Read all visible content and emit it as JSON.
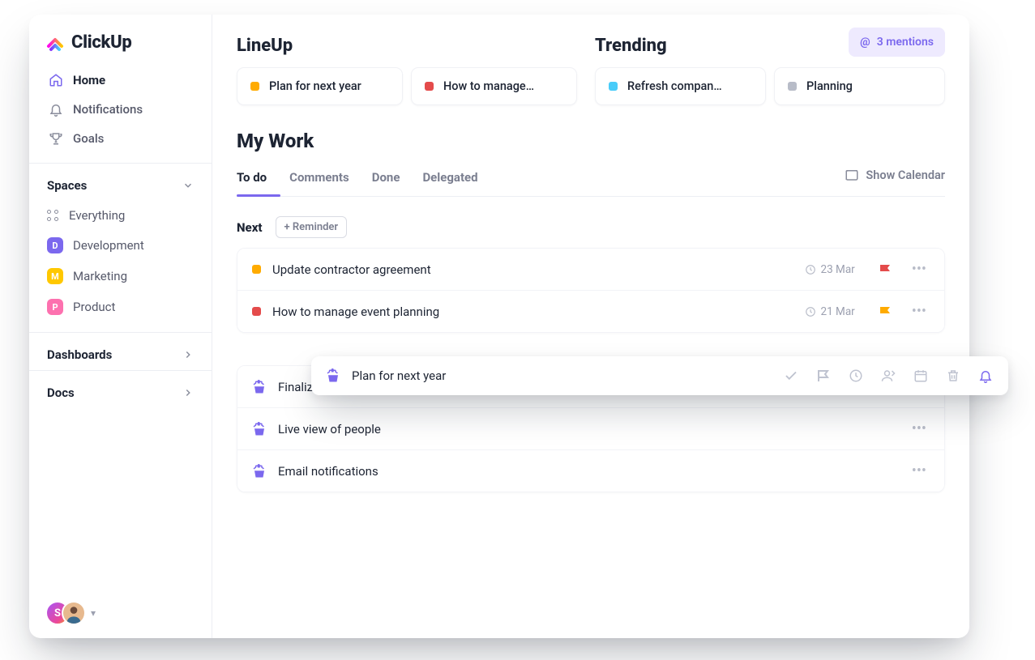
{
  "brand": {
    "name": "ClickUp"
  },
  "nav": {
    "home": "Home",
    "notifications": "Notifications",
    "goals": "Goals"
  },
  "spaces": {
    "header": "Spaces",
    "everything": "Everything",
    "items": [
      {
        "letter": "D",
        "label": "Development",
        "color": "#7b68ee"
      },
      {
        "letter": "M",
        "label": "Marketing",
        "color": "#ffc800"
      },
      {
        "letter": "P",
        "label": "Product",
        "color": "#fd71af"
      }
    ]
  },
  "bottomNav": {
    "dashboards": "Dashboards",
    "docs": "Docs"
  },
  "footer": {
    "avatar_letter": "S"
  },
  "mentions": {
    "label": "3 mentions"
  },
  "lineup": {
    "title": "LineUp",
    "cards": [
      {
        "label": "Plan for next year",
        "color": "orange"
      },
      {
        "label": "How to manage…",
        "color": "red"
      }
    ]
  },
  "trending": {
    "title": "Trending",
    "cards": [
      {
        "label": "Refresh compan…",
        "color": "cyan"
      },
      {
        "label": "Planning",
        "color": "grey"
      }
    ]
  },
  "mywork": {
    "title": "My Work",
    "tabs": [
      "To do",
      "Comments",
      "Done",
      "Delegated"
    ],
    "active_tab": "To do",
    "show_calendar": "Show Calendar",
    "next_label": "Next",
    "reminder_button": "+ Reminder",
    "tasks_next": [
      {
        "icon": "sq",
        "color": "orange",
        "title": "Update contractor agreement",
        "date": "23 Mar",
        "flag": "#e44b4b"
      },
      {
        "icon": "sq",
        "color": "red",
        "title": "How to manage event planning",
        "date": "21 Mar",
        "flag": "#ffab00"
      }
    ],
    "tasks_later": [
      {
        "icon": "reminder",
        "title": "Finalize project scope"
      },
      {
        "icon": "reminder",
        "title": "Live view of people"
      },
      {
        "icon": "reminder",
        "title": "Email notifications"
      }
    ]
  },
  "popover": {
    "title": "Plan for next year"
  }
}
